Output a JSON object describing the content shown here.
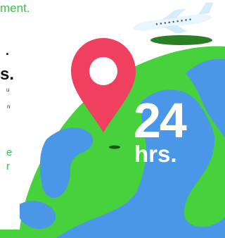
{
  "header": {
    "partial_title": "ment."
  },
  "left_text": {
    "bullet": ".",
    "partial_heading": "s.",
    "line_1": "u",
    "line_2": "n",
    "green_1": "e",
    "green_2": "r"
  },
  "hero": {
    "time_value": "24",
    "time_unit": "hrs."
  },
  "colors": {
    "globe_green": "#46d13d",
    "ocean_blue": "#4a97e8",
    "pin_red": "#f0405f",
    "accent_green": "#37c24b"
  },
  "icons": {
    "pin": "map-pin-icon",
    "plane": "airplane-icon",
    "globe": "globe-illustration"
  }
}
